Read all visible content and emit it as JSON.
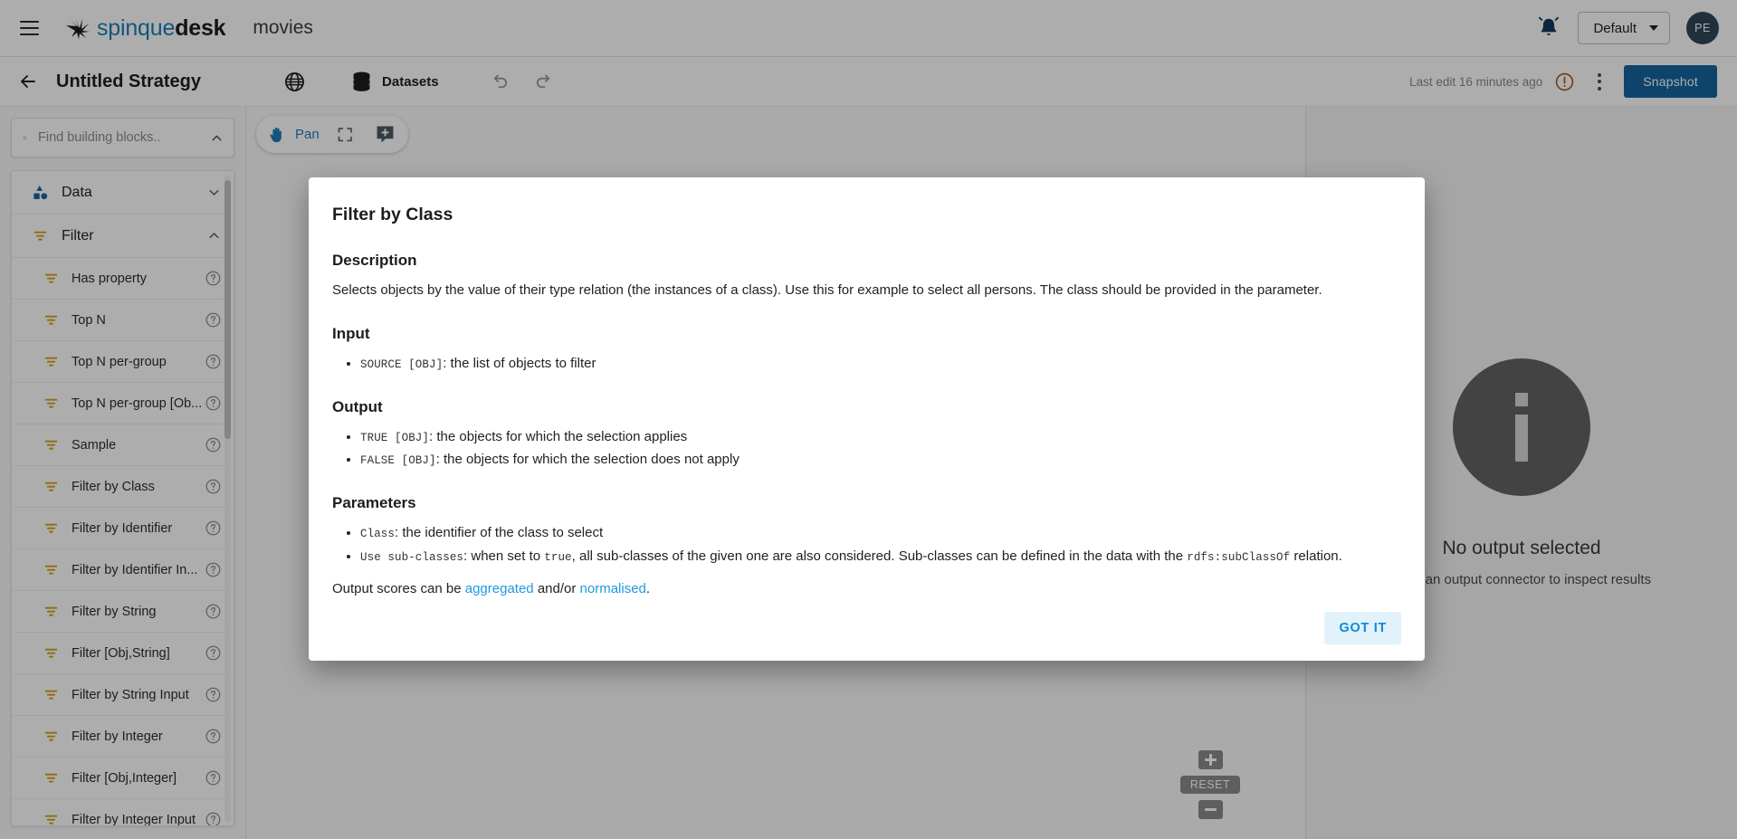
{
  "header": {
    "menu_icon": "hamburger-icon",
    "brand_primary": "spinque",
    "brand_secondary": "desk",
    "workspace": "movies",
    "notifications_icon": "bell-icon",
    "profile_select_value": "Default",
    "avatar_initials": "PE"
  },
  "strategybar": {
    "back_icon": "arrow-left-icon",
    "title": "Untitled Strategy",
    "globe_icon": "globe-icon",
    "datasets_icon": "database-icon",
    "datasets_label": "Datasets",
    "undo_icon": "undo-icon",
    "redo_icon": "redo-icon",
    "last_edit": "Last edit 16 minutes ago",
    "warning_icon": "alert-circle-icon",
    "more_icon": "kebab-menu-icon",
    "snapshot_label": "Snapshot"
  },
  "sidebar": {
    "search": {
      "icon": "search-icon",
      "placeholder": "Find building blocks..",
      "value": "",
      "collapse_icon": "chevron-up-icon"
    },
    "groups": [
      {
        "label": "Data",
        "icon": "data-shapes-icon",
        "expanded": false,
        "chevron": "chevron-down-icon"
      },
      {
        "label": "Filter",
        "icon": "filter-icon",
        "expanded": true,
        "chevron": "chevron-up-icon"
      }
    ],
    "items": [
      {
        "label": "Has property",
        "icon": "filter-icon",
        "help": "help-icon"
      },
      {
        "label": "Top N",
        "icon": "filter-icon",
        "help": "help-icon"
      },
      {
        "label": "Top N per-group",
        "icon": "filter-icon",
        "help": "help-icon"
      },
      {
        "label": "Top N per-group [Ob...",
        "icon": "filter-icon",
        "help": "help-icon"
      },
      {
        "label": "Sample",
        "icon": "filter-icon",
        "help": "help-icon"
      },
      {
        "label": "Filter by Class",
        "icon": "filter-icon",
        "help": "help-icon"
      },
      {
        "label": "Filter by Identifier",
        "icon": "filter-icon",
        "help": "help-icon"
      },
      {
        "label": "Filter by Identifier In...",
        "icon": "filter-icon",
        "help": "help-icon"
      },
      {
        "label": "Filter by String",
        "icon": "filter-icon",
        "help": "help-icon"
      },
      {
        "label": "Filter [Obj,String]",
        "icon": "filter-icon",
        "help": "help-icon"
      },
      {
        "label": "Filter by String Input",
        "icon": "filter-icon",
        "help": "help-icon"
      },
      {
        "label": "Filter by Integer",
        "icon": "filter-icon",
        "help": "help-icon"
      },
      {
        "label": "Filter [Obj,Integer]",
        "icon": "filter-icon",
        "help": "help-icon"
      },
      {
        "label": "Filter by Integer Input",
        "icon": "filter-icon",
        "help": "help-icon"
      }
    ]
  },
  "canvas": {
    "toolbar": {
      "pan_icon": "hand-icon",
      "pan_label": "Pan",
      "fit_icon": "fit-screen-icon",
      "add_note_icon": "add-note-icon"
    },
    "zoom": {
      "zoom_in_icon": "plus-icon",
      "reset_label": "RESET",
      "zoom_out_icon": "minus-icon"
    }
  },
  "right_panel": {
    "icon": "info-circle-icon",
    "title": "No output selected",
    "subtitle": "Click an output connector to inspect results"
  },
  "modal": {
    "title": "Filter by Class",
    "sections": {
      "description_heading": "Description",
      "description_text": "Selects objects by the value of their type relation (the instances of a class). Use this for example to select all persons. The class should be provided in the parameter.",
      "input_heading": "Input",
      "input_items": [
        {
          "code": "SOURCE [OBJ]",
          "text": ": the list of objects to filter"
        }
      ],
      "output_heading": "Output",
      "output_items": [
        {
          "code": "TRUE [OBJ]",
          "text": ": the objects for which the selection applies"
        },
        {
          "code": "FALSE [OBJ]",
          "text": ": the objects for which the selection does not apply"
        }
      ],
      "parameters_heading": "Parameters",
      "parameter_items": [
        {
          "code": "Class",
          "text": ": the identifier of the class to select"
        }
      ],
      "subclasses_code": "Use sub-classes",
      "subclasses_text_1": ": when set to ",
      "subclasses_true": "true",
      "subclasses_text_2": ", all sub-classes of the given one are also considered. Sub-classes can be defined in the data with the ",
      "subclasses_relation": "rdfs:subClassOf",
      "subclasses_text_3": " relation.",
      "scores_prefix": "Output scores can be ",
      "scores_link_1": "aggregated",
      "scores_middle": " and/or ",
      "scores_link_2": "normalised",
      "scores_suffix": "."
    },
    "confirm_label": "GOT IT"
  },
  "colors": {
    "brand_blue": "#1b7fb8",
    "accent_blue": "#1565a0",
    "link_blue": "#1e9ae0",
    "filter_yellow": "#d4a017",
    "bell_navy": "#14395c",
    "warning_orange": "#c06a1f"
  }
}
